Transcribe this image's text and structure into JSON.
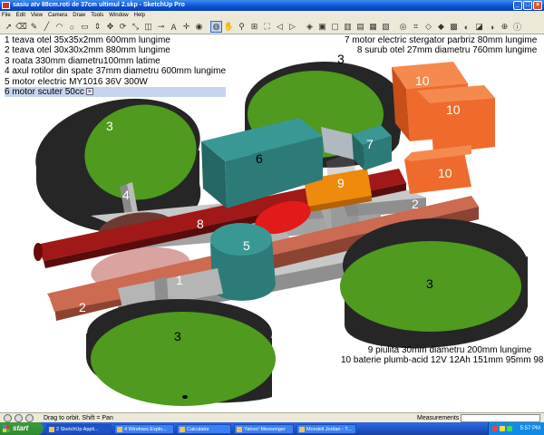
{
  "window": {
    "title": "sasiu atv 88cm.roti de 37cm ultimul 2.skp - SketchUp Pro"
  },
  "menu": [
    "File",
    "Edit",
    "View",
    "Camera",
    "Draw",
    "Tools",
    "Window",
    "Help"
  ],
  "toolbar_icons": [
    "select-icon",
    "eraser-icon",
    "pencil-icon",
    "line-icon",
    "arc-icon",
    "circle-icon",
    "rectangle-icon",
    "pushpull-icon",
    "move-icon",
    "rotate-icon",
    "scale-icon",
    "offset-icon",
    "tape-icon",
    "text-icon",
    "axes-icon",
    "paint-icon",
    "orbit-icon",
    "pan-icon",
    "zoom-icon",
    "zoom-window-icon",
    "zoom-extents-icon",
    "previous-icon",
    "next-icon",
    "iso-icon",
    "top-icon",
    "front-icon",
    "right-icon",
    "back-icon",
    "left-icon",
    "bottom-icon",
    "xray-icon",
    "wireframe-icon",
    "hidden-line-icon",
    "shaded-icon",
    "textured-icon",
    "monochrome-icon",
    "section-icon",
    "shadow-icon",
    "geo-icon",
    "model-info-icon"
  ],
  "legend_left": [
    "1 teava otel 35x35x2mm 600mm lungime",
    "2 teava otel 30x30x2mm 880mm lungime",
    "3 roata 330mm diametru100mm latime",
    "4 axul rotilor din spate 37mm diametru 600mm lungime",
    "5 motor electric MY1016 36V 300W"
  ],
  "legend_left_selected": "6 motor scuter 50cc",
  "legend_right": [
    "7 motor electric stergator parbriz 80mm lungime",
    "8 surub otel 27mm diametru 760mm lungime"
  ],
  "legend_bottom": [
    "9 piulita 30mm diametru 200mm lungime",
    "10 baterie plumb-acid 12V 12Ah 151mm 95mm 98mm"
  ],
  "model_labels": {
    "wheel_back_left": "3",
    "wheel_back_right": "3",
    "wheel_front_right": "3",
    "wheel_front_left": "3",
    "axle": "4",
    "motor_scooter": "6",
    "wiper_motor": "7",
    "bolt": "8",
    "nut": "9",
    "battery_top_left": "10",
    "battery_top_right": "10",
    "battery_bottom": "10",
    "electric_motor": "5",
    "tube_short": "1",
    "tube_long_left": "2",
    "tube_long_right": "2"
  },
  "status": {
    "hint": "Drag to orbit.  Shift = Pan",
    "measurements_label": "Measurements"
  },
  "taskbar": {
    "start": "start",
    "tasks": [
      {
        "label": "2 SketchUp Appli...",
        "active": true
      },
      {
        "label": "4 Windows Explo...",
        "active": false
      },
      {
        "label": "Calculator",
        "active": false
      },
      {
        "label": "Yahoo! Messenger",
        "active": false
      },
      {
        "label": "Mondell Jordan - T...",
        "active": false
      }
    ],
    "clock": "5:57 PM"
  },
  "colors": {
    "wheel_green": "#4f9a1f",
    "wheel_tire": "#262626",
    "motor_teal": "#2d7b78",
    "battery_orange": "#ee6b2d",
    "bolt_red": "#8c1414",
    "nut_orange": "#ee8a0c",
    "frame_grey": "#a3a3a3",
    "tube_brown": "#b0563f"
  }
}
